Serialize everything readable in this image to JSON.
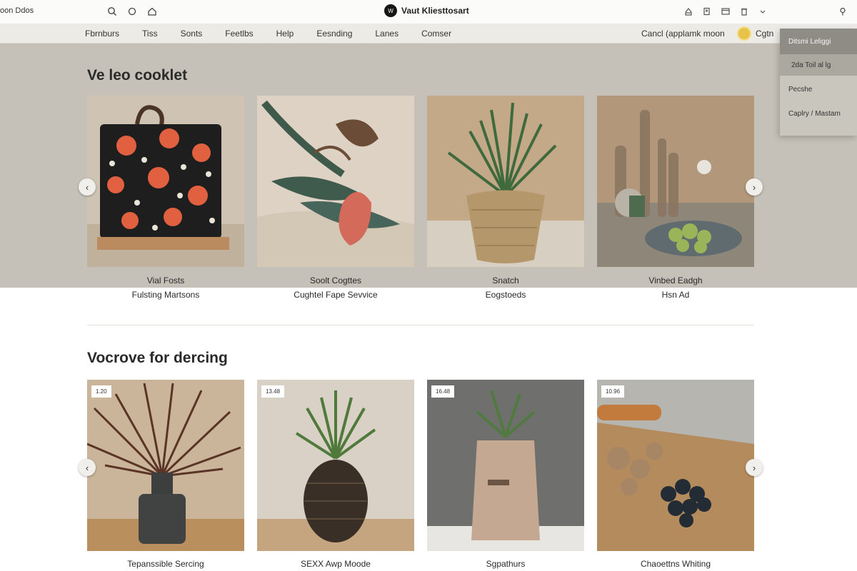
{
  "header": {
    "left_text": "oon Ddos",
    "brand_logo_text": "W",
    "brand_name": "Vaut Kliesttosart"
  },
  "nav": {
    "items": [
      "Fbrnburs",
      "Tiss",
      "Sonts",
      "Feetlbs",
      "Help",
      "Eesnding",
      "Lanes",
      "Comser"
    ],
    "account_text": "Cancl (applamk moon",
    "account_name": "Cgtn"
  },
  "dropdown": {
    "items": [
      "Ditsmi Leliggi",
      "2da Toil al lg",
      "Pecshe",
      "Caplry / Mastam"
    ]
  },
  "section1": {
    "title": "Ve leo cooklet",
    "cards": [
      {
        "line1": "Vial Fosts",
        "line2": "Fulsting Martsons"
      },
      {
        "line1": "Soolt Cogttes",
        "line2": "Cughtel Fape Sevvice"
      },
      {
        "line1": "Snatch",
        "line2": "Eogstoeds"
      },
      {
        "line1": "Vinbed Eadgh",
        "line2": "Hsn Ad"
      }
    ]
  },
  "section2": {
    "title": "Vocrove for dercing",
    "cards": [
      {
        "badge": "1.20",
        "line1": "Tepanssible Sercing"
      },
      {
        "badge": "13.48",
        "line1": "SEXX Awp Moode"
      },
      {
        "badge": "16.48",
        "line1": "Sgpathurs"
      },
      {
        "badge": "10.96",
        "line1": "Chaoettns Whiting"
      }
    ]
  },
  "icons": {
    "header_left": [
      "search-icon",
      "circle-icon",
      "home-icon"
    ],
    "header_right": [
      "share-icon",
      "copy-icon",
      "window-icon",
      "trash-icon",
      "chevron-down-icon"
    ],
    "header_end": "pin-icon"
  }
}
